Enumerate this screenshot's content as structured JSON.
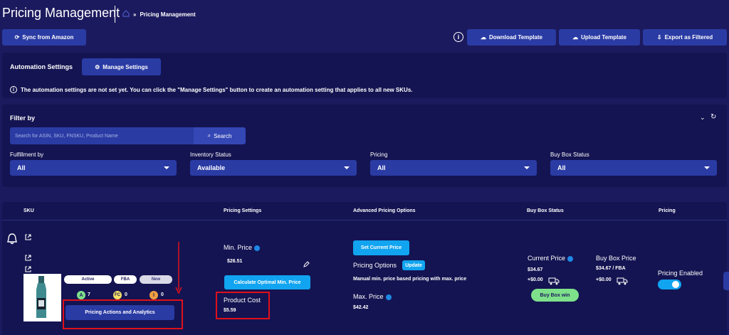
{
  "header": {
    "title": "Pricing Management",
    "breadcrumb_sep": "»",
    "breadcrumb_current": "Pricing Management"
  },
  "toolbar": {
    "sync_label": "Sync from Amazon",
    "download_label": "Download Template",
    "upload_label": "Upload Template",
    "export_label": "Export as Filtered"
  },
  "automation": {
    "title": "Automation Settings",
    "manage_label": "Manage Settings",
    "notice": "The automation settings are not set yet. You can click the \"Manage Settings\" button to create an automation setting that applies to all new SKUs."
  },
  "filter": {
    "title": "Filter by",
    "search_placeholder": "Search for ASIN, SKU, FNSKU, Product Name",
    "search_button": "Search",
    "fields": [
      {
        "label": "Fulfillment by",
        "value": "All"
      },
      {
        "label": "Inventory Status",
        "value": "Available"
      },
      {
        "label": "Pricing",
        "value": "All"
      },
      {
        "label": "Buy Box Status",
        "value": "All"
      }
    ]
  },
  "table": {
    "headers": {
      "sku": "SKU",
      "pricing_settings": "Pricing Settings",
      "advanced": "Advanced Pricing Options",
      "buybox": "Buy Box Status",
      "pricing": "Pricing"
    },
    "row": {
      "badges": {
        "status": "Active",
        "fulfillment": "FBA",
        "condition": "New"
      },
      "counts": [
        {
          "letter": "A",
          "count": "7",
          "color": "#7ee08a"
        },
        {
          "letter": "FC",
          "count": "0",
          "color": "#f5e066"
        },
        {
          "letter": "I",
          "count": "0",
          "color": "#f0a040"
        }
      ],
      "actions_label": "Pricing Actions and Analytics",
      "min_price_label": "Min. Price",
      "min_price_value": "$26.51",
      "calc_min_label": "Calculate Optimal Min. Price",
      "product_cost_label": "Product Cost",
      "product_cost_value": "$5.59",
      "set_current_label": "Set Current Price",
      "pricing_options_label": "Pricing Options",
      "update_label": "Update",
      "pricing_desc": "Manual min. price based pricing with max. price",
      "max_price_label": "Max. Price",
      "max_price_value": "$42.42",
      "current_price_label": "Current Price",
      "current_price_value": "$34.67",
      "current_shipping": "+$0.00",
      "buybox_price_label": "Buy Box Price",
      "buybox_price_value": "$34.67 / FBA",
      "buybox_shipping": "+$0.00",
      "buybox_win_label": "Buy Box win",
      "pricing_enabled_label": "Pricing Enabled",
      "pricing_enabled": true
    }
  },
  "colors": {
    "background": "#1c1a5e",
    "panel": "#141452",
    "button": "#2a3ba4",
    "accent": "#11a4f0",
    "highlight": "#e0101a",
    "success": "#7ee08a"
  }
}
